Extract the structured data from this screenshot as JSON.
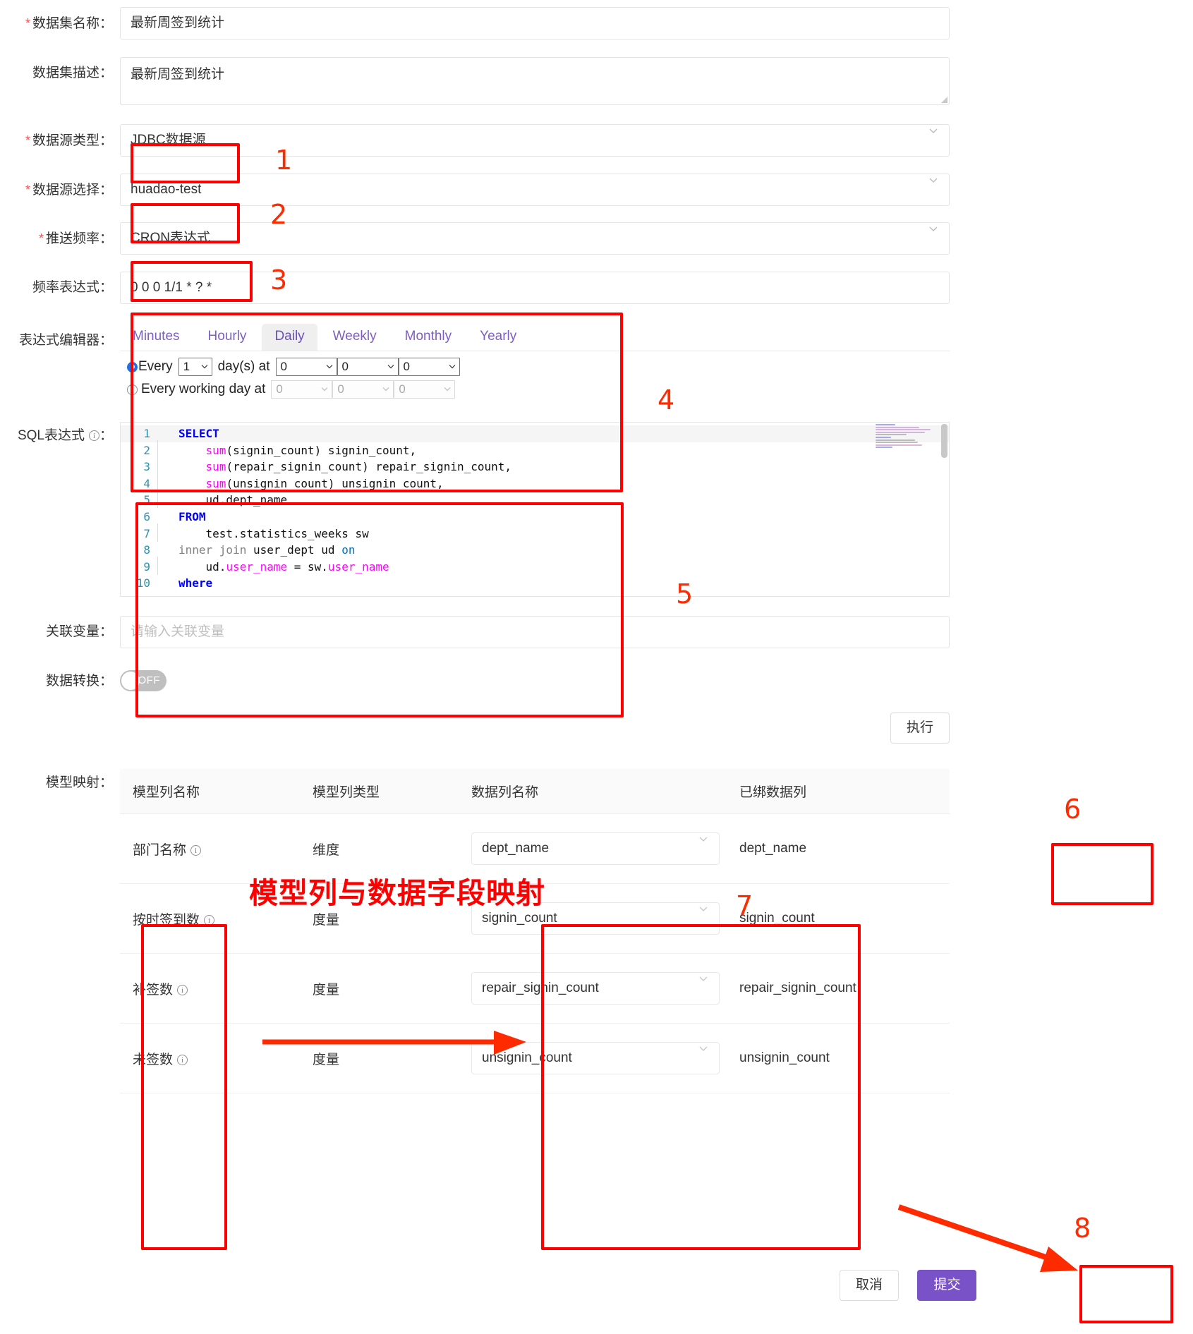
{
  "form": {
    "dataset_name": {
      "label": "数据集名称：",
      "required": true,
      "value": "最新周签到统计"
    },
    "dataset_desc": {
      "label": "数据集描述：",
      "required": false,
      "value": "最新周签到统计"
    },
    "datasource_type": {
      "label": "数据源类型：",
      "required": true,
      "value": "JDBC数据源"
    },
    "datasource_select": {
      "label": "数据源选择：",
      "required": true,
      "value": "huadao-test"
    },
    "push_frequency": {
      "label": "推送频率：",
      "required": true,
      "value": "CRON表达式"
    },
    "freq_expression": {
      "label": "频率表达式：",
      "required": false,
      "value": "0 0 0 1/1 * ? *"
    },
    "expression_editor": {
      "label": "表达式编辑器："
    },
    "sql_expression": {
      "label": "SQL表达式",
      "label_suffix": "：",
      "info_icon": "info-icon"
    },
    "related_variable": {
      "label": "关联变量：",
      "placeholder": "请输入关联变量",
      "value": ""
    },
    "data_transform": {
      "label": "数据转换：",
      "toggle_state": "OFF"
    },
    "model_mapping": {
      "label": "模型映射："
    }
  },
  "cron": {
    "tabs": [
      {
        "label": "Minutes",
        "active": false
      },
      {
        "label": "Hourly",
        "active": false
      },
      {
        "label": "Daily",
        "active": true
      },
      {
        "label": "Weekly",
        "active": false
      },
      {
        "label": "Monthly",
        "active": false
      },
      {
        "label": "Yearly",
        "active": false
      }
    ],
    "option_every": {
      "selected": true,
      "prefix": "Every",
      "day_value": "1",
      "middle": "day(s) at",
      "time": [
        "0",
        "0",
        "0"
      ]
    },
    "option_working": {
      "selected": false,
      "prefix": "Every working day at",
      "time": [
        "0",
        "0",
        "0"
      ]
    }
  },
  "sql": {
    "lines": [
      {
        "n": "1",
        "segments": [
          {
            "t": "SELECT",
            "c": "kw-blue"
          }
        ],
        "indent": false
      },
      {
        "n": "2",
        "segments": [
          {
            "t": "    "
          },
          {
            "t": "sum",
            "c": "kw-fn"
          },
          {
            "t": "(signin_count) signin_count,"
          }
        ],
        "indent": true
      },
      {
        "n": "3",
        "segments": [
          {
            "t": "    "
          },
          {
            "t": "sum",
            "c": "kw-fn"
          },
          {
            "t": "(repair_signin_count) repair_signin_count,"
          }
        ],
        "indent": true
      },
      {
        "n": "4",
        "segments": [
          {
            "t": "    "
          },
          {
            "t": "sum",
            "c": "kw-fn"
          },
          {
            "t": "(unsignin_count) unsignin_count,"
          }
        ],
        "indent": true
      },
      {
        "n": "5",
        "segments": [
          {
            "t": "    ud.dept_name"
          }
        ],
        "indent": true
      },
      {
        "n": "6",
        "segments": [
          {
            "t": "FROM",
            "c": "kw-blue"
          }
        ],
        "indent": false
      },
      {
        "n": "7",
        "segments": [
          {
            "t": "    test.statistics_weeks sw"
          }
        ],
        "indent": true
      },
      {
        "n": "8",
        "segments": [
          {
            "t": "inner join",
            "c": "kw-gray"
          },
          {
            "t": " user_dept ud "
          },
          {
            "t": "on",
            "c": "kw-cy"
          }
        ],
        "indent": false
      },
      {
        "n": "9",
        "segments": [
          {
            "t": "    ud."
          },
          {
            "t": "user_name",
            "c": "kw-mag"
          },
          {
            "t": " = sw."
          },
          {
            "t": "user_name",
            "c": "kw-mag"
          }
        ],
        "indent": true
      },
      {
        "n": "10",
        "segments": [
          {
            "t": "where",
            "c": "kw-blue"
          }
        ],
        "indent": false
      }
    ]
  },
  "buttons": {
    "execute": "执行",
    "cancel": "取消",
    "submit": "提交"
  },
  "mapping_table": {
    "headers": [
      "模型列名称",
      "模型列类型",
      "数据列名称",
      "已绑数据列"
    ],
    "rows": [
      {
        "model_col": "部门名称",
        "model_type": "维度",
        "data_col": "dept_name",
        "bound_col": "dept_name"
      },
      {
        "model_col": "按时签到数",
        "model_type": "度量",
        "data_col": "signin_count",
        "bound_col": "signin_count"
      },
      {
        "model_col": "补签数",
        "model_type": "度量",
        "data_col": "repair_signin_count",
        "bound_col": "repair_signin_count"
      },
      {
        "model_col": "未签数",
        "model_type": "度量",
        "data_col": "unsignin_count",
        "bound_col": "unsignin_count"
      }
    ]
  },
  "annotations": {
    "title": "模型列与数据字段映射",
    "numbers": [
      "1",
      "2",
      "3",
      "4",
      "5",
      "6",
      "7",
      "8"
    ],
    "color": "#fe0000"
  }
}
